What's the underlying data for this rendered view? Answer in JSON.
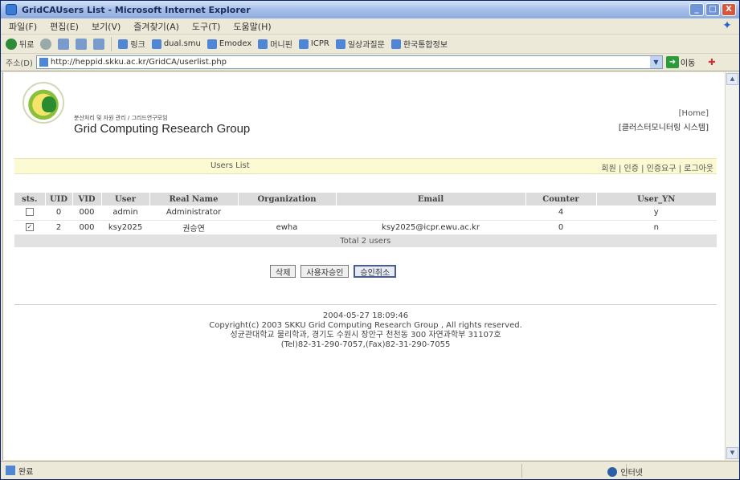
{
  "window": {
    "title": "GridCAUsers List - Microsoft Internet Explorer",
    "buttons": [
      "_",
      "□",
      "X"
    ]
  },
  "menubar": [
    "파일(F)",
    "편집(E)",
    "보기(V)",
    "즐겨찾기(A)",
    "도구(T)",
    "도움말(H)"
  ],
  "toolbar": {
    "back_label": "뒤로",
    "links": [
      "링크",
      "dual.smu",
      "Emodex",
      "머니핀",
      "ICPR",
      "일상과질문",
      "한국통합정보"
    ]
  },
  "address": {
    "label": "주소(D)",
    "url": "http://heppid.skku.ac.kr/GridCA/userlist.php",
    "go_label": "이동"
  },
  "header": {
    "group_sub": "분산처리 및 자원 관리 / 그리드연구모임",
    "group_name": "Grid Computing Research Group",
    "home_link": "[Home]",
    "system_name": "[클러스터모니터링 시스템]"
  },
  "nav": {
    "page_title": "Users List",
    "links": "회원 | 인증 | 인증요구 | 로그아웃"
  },
  "table": {
    "headers": [
      "sts.",
      "UID",
      "VID",
      "User",
      "Real Name",
      "Organization",
      "Email",
      "Counter",
      "User_YN"
    ],
    "rows": [
      {
        "checked": false,
        "uid": "0",
        "vid": "000",
        "user": "admin",
        "real_name": "Administrator",
        "organization": "",
        "email": "",
        "counter": "4",
        "user_yn": "y"
      },
      {
        "checked": true,
        "uid": "2",
        "vid": "000",
        "user": "ksy2025",
        "real_name": "권승연",
        "organization": "ewha",
        "email": "ksy2025@icpr.ewu.ac.kr",
        "counter": "0",
        "user_yn": "n"
      }
    ],
    "total": "Total 2 users"
  },
  "buttons": {
    "delete": "삭제",
    "approve": "사용자승인",
    "cancel": "승인취소"
  },
  "footer": {
    "timestamp": "2004-05-27 18:09:46",
    "copyright": "Copyright(c) 2003 SKKU Grid Computing Research Group , All rights reserved.",
    "address": "성균관대학교 물리학과, 경기도 수원시 장안구 천천동 300 자연과학부 31107호",
    "phone": "(Tel)82-31-290-7057,(Fax)82-31-290-7055"
  },
  "status": {
    "text": "완료",
    "zone": "인터넷"
  }
}
